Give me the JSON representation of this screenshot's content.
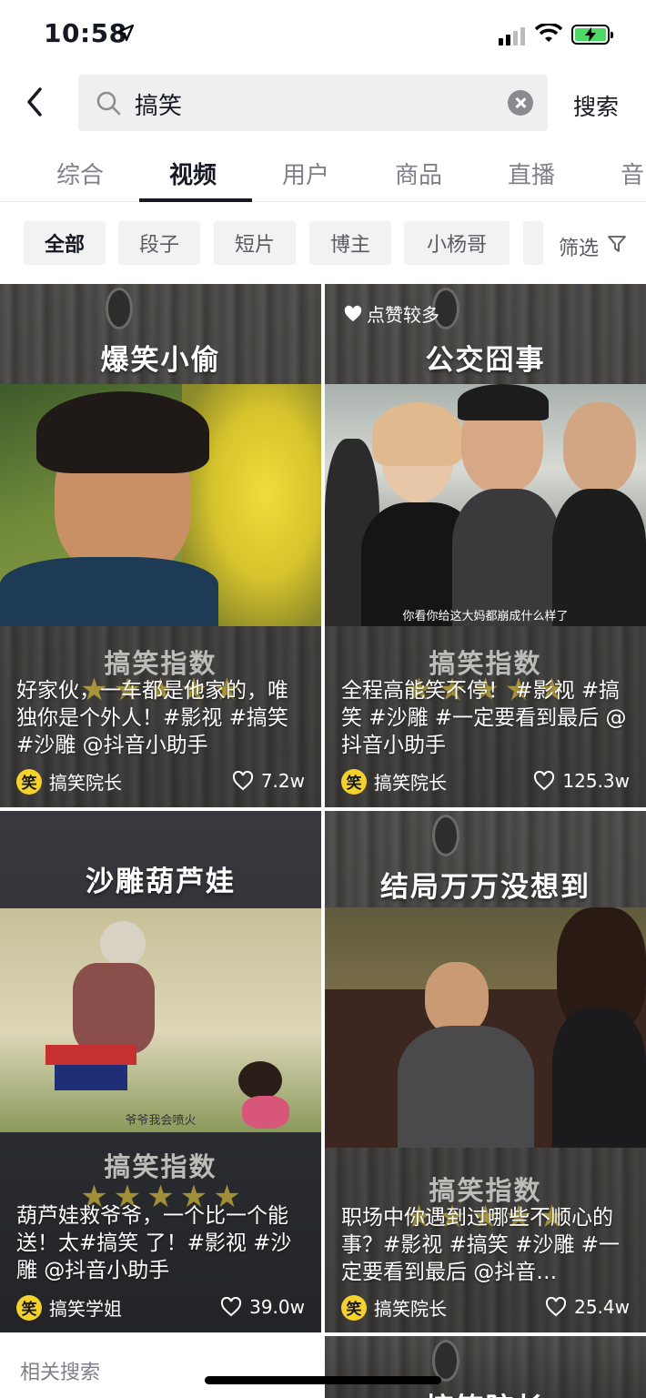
{
  "status": {
    "time": "10:58"
  },
  "search": {
    "query": "搞笑",
    "button": "搜索"
  },
  "tabs": [
    "综合",
    "视频",
    "用户",
    "商品",
    "直播",
    "音"
  ],
  "chips": [
    "全部",
    "段子",
    "短片",
    "博主",
    "小杨哥"
  ],
  "filter": "筛选",
  "index_label": "搞笑指数",
  "cards": [
    {
      "heading": "爆笑小偷",
      "desc": "好家伙，一车都是他家的，唯独你是个外人！#影视 #搞笑 #沙雕 @抖音小助手",
      "author": "搞笑院长",
      "avatar": "笑",
      "likes": "7.2w"
    },
    {
      "heading": "公交囧事",
      "badge": "点赞较多",
      "subtitle": "你看你给这大妈都崩成什么样了",
      "desc": "全程高能笑不停！ #影视 #搞笑  #沙雕 #一定要看到最后 @抖音小助手",
      "author": "搞笑院长",
      "avatar": "笑",
      "likes": "125.3w"
    },
    {
      "heading": "沙雕葫芦娃",
      "subtitle": "爷爷我会喷火",
      "desc": "葫芦娃救爷爷，一个比一个能送！太#搞笑 了！#影视 #沙雕 @抖音小助手",
      "author": "搞笑学姐",
      "avatar": "笑",
      "likes": "39.0w"
    },
    {
      "heading": "结局万万没想到",
      "desc": "职场中你遇到过哪些不顺心的事？#影视 #搞笑 #沙雕 #一定要看到最后 @抖音…",
      "author": "搞笑院长",
      "avatar": "笑",
      "likes": "25.4w"
    }
  ],
  "partial_card_heading": "搞笑院长",
  "related": "相关搜索"
}
